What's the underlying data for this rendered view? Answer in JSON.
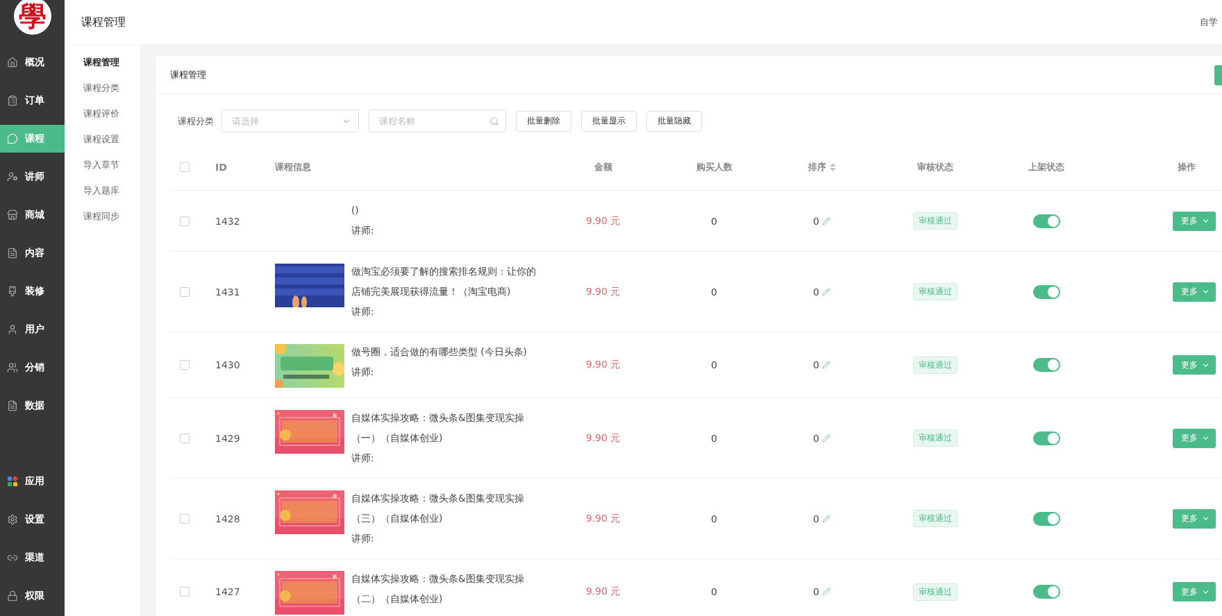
{
  "logo": {
    "text": "學"
  },
  "sidebar": {
    "items": [
      {
        "label": "概况",
        "selected": false
      },
      {
        "label": "订单",
        "selected": false
      },
      {
        "label": "课程",
        "selected": true
      },
      {
        "label": "讲师",
        "selected": false
      },
      {
        "label": "商城",
        "selected": false
      },
      {
        "label": "内容",
        "selected": false
      },
      {
        "label": "装修",
        "selected": false
      },
      {
        "label": "用户",
        "selected": false
      },
      {
        "label": "分销",
        "selected": false
      },
      {
        "label": "数据",
        "selected": false
      }
    ],
    "bottom_items": [
      {
        "label": "应用",
        "selected": false
      },
      {
        "label": "设置",
        "selected": false
      },
      {
        "label": "渠道",
        "selected": false
      },
      {
        "label": "权限",
        "selected": false
      }
    ]
  },
  "topbar": {
    "title": "课程管理",
    "user": "自学"
  },
  "subnav": {
    "items": [
      {
        "label": "课程管理",
        "selected": true
      },
      {
        "label": "课程分类",
        "selected": false
      },
      {
        "label": "课程评价",
        "selected": false
      },
      {
        "label": "课程设置",
        "selected": false
      },
      {
        "label": "导入章节",
        "selected": false
      },
      {
        "label": "导入题库",
        "selected": false
      },
      {
        "label": "课程同步",
        "selected": false
      }
    ]
  },
  "card": {
    "title": "课程管理"
  },
  "filters": {
    "category_label": "课程分类",
    "category_placeholder": "请选择",
    "name_placeholder": "课程名称",
    "buttons": [
      "批量删除",
      "批量显示",
      "批量隐藏"
    ]
  },
  "table": {
    "select_all": false,
    "columns": [
      "ID",
      "课程信息",
      "金额",
      "购买人数",
      "排序",
      "审核状态",
      "上架状态",
      "操作"
    ],
    "rows": [
      {
        "checked": false,
        "id": "1432",
        "title": "()",
        "teacher": "讲师:",
        "price": "9.90 元",
        "buyers": "0",
        "sort": "0",
        "review": "审核通过",
        "listed": true,
        "action": "更多"
      },
      {
        "checked": false,
        "id": "1431",
        "title": "做淘宝必须要了解的搜索排名规则：让你的店铺完美展现获得流量！（淘宝电商)",
        "teacher": "讲师:",
        "price": "9.90 元",
        "buyers": "0",
        "sort": "0",
        "review": "审核通过",
        "listed": true,
        "action": "更多"
      },
      {
        "checked": false,
        "id": "1430",
        "title": "做号圈，适合做的有哪些类型 (今日头条)",
        "teacher": "讲师:",
        "price": "9.90 元",
        "buyers": "0",
        "sort": "0",
        "review": "审核通过",
        "listed": true,
        "action": "更多"
      },
      {
        "checked": false,
        "id": "1429",
        "title": "自媒体实操攻略：微头条&图集变现实操（一）（自媒体创业)",
        "teacher": "讲师:",
        "price": "9.90 元",
        "buyers": "0",
        "sort": "0",
        "review": "审核通过",
        "listed": true,
        "action": "更多"
      },
      {
        "checked": false,
        "id": "1428",
        "title": "自媒体实操攻略：微头条&图集变现实操（三）（自媒体创业)",
        "teacher": "讲师:",
        "price": "9.90 元",
        "buyers": "0",
        "sort": "0",
        "review": "审核通过",
        "listed": true,
        "action": "更多"
      },
      {
        "checked": false,
        "id": "1427",
        "title": "自媒体实操攻略：微头条&图集变现实操（二）（自媒体创业)",
        "price": "9.90 元",
        "buyers": "0",
        "sort": "0",
        "review": "审核通过",
        "listed": true,
        "action": "更多"
      }
    ]
  }
}
